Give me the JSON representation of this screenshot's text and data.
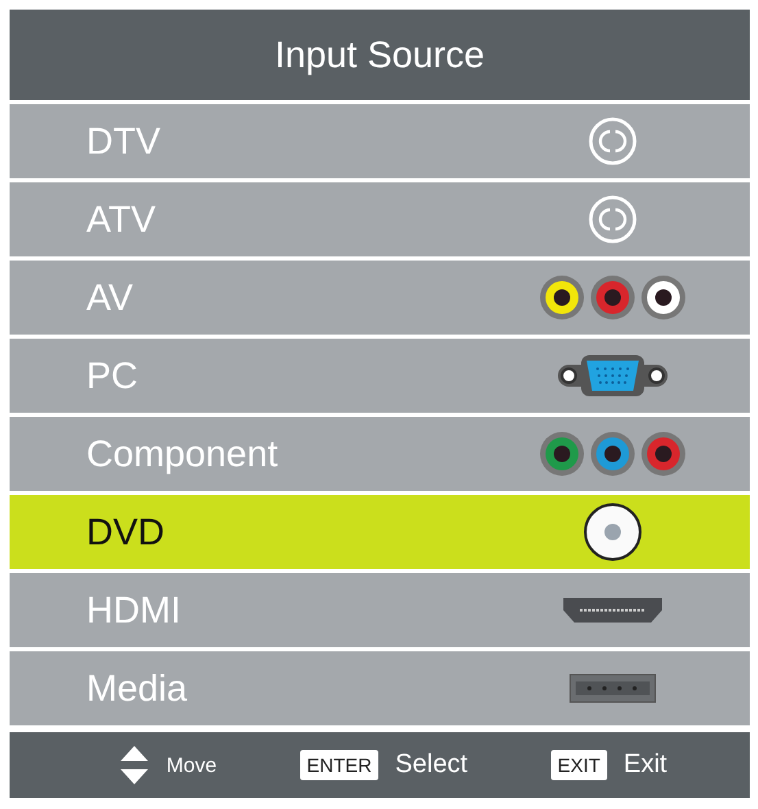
{
  "title": "Input Source",
  "sources": [
    {
      "label": "DTV",
      "kind": "coax",
      "selected": false
    },
    {
      "label": "ATV",
      "kind": "coax",
      "selected": false
    },
    {
      "label": "AV",
      "kind": "av",
      "selected": false
    },
    {
      "label": "PC",
      "kind": "vga",
      "selected": false
    },
    {
      "label": "Component",
      "kind": "component",
      "selected": false
    },
    {
      "label": "DVD",
      "kind": "disc",
      "selected": true
    },
    {
      "label": "HDMI",
      "kind": "hdmi",
      "selected": false
    },
    {
      "label": "Media",
      "kind": "usb",
      "selected": false
    }
  ],
  "hints": [
    {
      "kind": "arrows",
      "text": "Move"
    },
    {
      "kind": "key",
      "key": "ENTER",
      "text": "Select"
    },
    {
      "kind": "key",
      "key": "EXIT",
      "text": "Exit"
    }
  ]
}
